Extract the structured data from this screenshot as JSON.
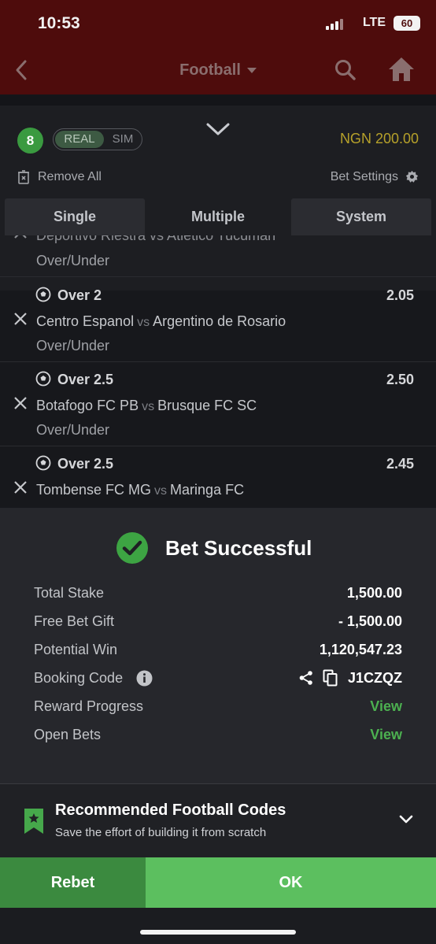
{
  "status_bar": {
    "time": "10:53",
    "network": "LTE",
    "battery": "60"
  },
  "header": {
    "title": "Football"
  },
  "slip": {
    "count": "8",
    "mode_real": "REAL",
    "mode_sim": "SIM",
    "balance": "NGN 200.00",
    "remove_all": "Remove All",
    "bet_settings": "Bet Settings",
    "tabs": {
      "single": "Single",
      "multiple": "Multiple",
      "system": "System"
    },
    "partial": {
      "teams": "Deportivo Riestra vs Atletico Tucuman",
      "market": "Over/Under"
    },
    "selections": [
      {
        "pick": "Over 2",
        "odds": "2.05",
        "home": "Centro Espanol",
        "vs": "vs",
        "away": "Argentino de Rosario",
        "market": "Over/Under"
      },
      {
        "pick": "Over 2.5",
        "odds": "2.50",
        "home": "Botafogo FC PB",
        "vs": "vs",
        "away": "Brusque FC SC",
        "market": "Over/Under"
      },
      {
        "pick": "Over 2.5",
        "odds": "2.45",
        "home": "Tombense FC MG",
        "vs": "vs",
        "away": "Maringa FC",
        "market": ""
      }
    ]
  },
  "success": {
    "title": "Bet Successful",
    "total_stake_label": "Total Stake",
    "total_stake": "1,500.00",
    "free_bet_label": "Free Bet Gift",
    "free_bet": "- 1,500.00",
    "potential_win_label": "Potential Win",
    "potential_win": "1,120,547.23",
    "booking_code_label": "Booking Code",
    "booking_code": "J1CZQZ",
    "reward_label": "Reward Progress",
    "reward_link": "View",
    "open_bets_label": "Open Bets",
    "open_bets_link": "View"
  },
  "recommended": {
    "title": "Recommended Football Codes",
    "subtitle": "Save the effort of building it from scratch"
  },
  "actions": {
    "rebet": "Rebet",
    "ok": "OK"
  },
  "colors": {
    "accent_green": "#4cb050",
    "ok_green": "#5cbf5f",
    "balance_gold": "#b6a12a",
    "header_red": "#4e0c0c"
  }
}
